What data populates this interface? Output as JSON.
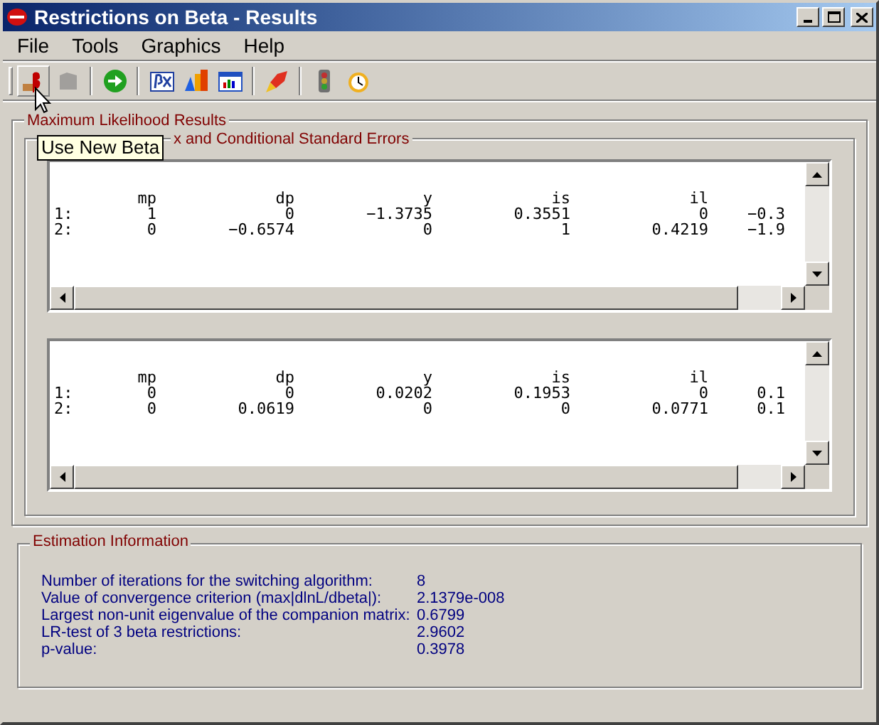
{
  "window": {
    "title": "Restrictions on Beta - Results"
  },
  "menu": [
    "File",
    "Tools",
    "Graphics",
    "Help"
  ],
  "toolbar": [
    {
      "kind": "beta",
      "disabled": false,
      "hovered": true
    },
    {
      "kind": "shape",
      "disabled": true,
      "hovered": false
    },
    {
      "kind": "sep"
    },
    {
      "kind": "go",
      "disabled": false,
      "hovered": false
    },
    {
      "kind": "sep"
    },
    {
      "kind": "betax",
      "disabled": false,
      "hovered": false
    },
    {
      "kind": "bars",
      "disabled": false,
      "hovered": false
    },
    {
      "kind": "chartwin",
      "disabled": false,
      "hovered": false
    },
    {
      "kind": "sep"
    },
    {
      "kind": "rocket",
      "disabled": false,
      "hovered": false
    },
    {
      "kind": "sep"
    },
    {
      "kind": "light",
      "disabled": false,
      "hovered": false
    },
    {
      "kind": "clock",
      "disabled": false,
      "hovered": false
    }
  ],
  "tooltip": "Use New Beta",
  "results_group": {
    "title": "Maximum Likelihood Results",
    "inner_title": "x and Conditional Standard Errors",
    "tables": [
      {
        "columns": [
          "mp",
          "dp",
          "y",
          "is",
          "il"
        ],
        "rows": [
          {
            "label": "1:",
            "cells": [
              "1",
              "0",
              "−1.3735",
              "0.3551",
              "0",
              "−0.3"
            ]
          },
          {
            "label": "2:",
            "cells": [
              "0",
              "−0.6574",
              "0",
              "1",
              "0.4219",
              "−1.9"
            ]
          }
        ]
      },
      {
        "columns": [
          "mp",
          "dp",
          "y",
          "is",
          "il"
        ],
        "rows": [
          {
            "label": "1:",
            "cells": [
              "0",
              "0",
              "0.0202",
              "0.1953",
              "0",
              "0.1"
            ]
          },
          {
            "label": "2:",
            "cells": [
              "0",
              "0.0619",
              "0",
              "0",
              "0.0771",
              "0.1"
            ]
          }
        ]
      }
    ]
  },
  "estimation": {
    "title": "Estimation Information",
    "rows": [
      {
        "label": "Number of iterations for the switching algorithm:",
        "value": "8"
      },
      {
        "label": "Value of convergence criterion (max|dlnL/dbeta|):",
        "value": "2.1379e-008"
      },
      {
        "label": "Largest non-unit eigenvalue of the companion matrix:",
        "value": "0.6799"
      },
      {
        "label": "LR-test of 3 beta restrictions:",
        "value": "2.9602"
      },
      {
        "label": "p-value:",
        "value": "0.3978"
      }
    ]
  }
}
